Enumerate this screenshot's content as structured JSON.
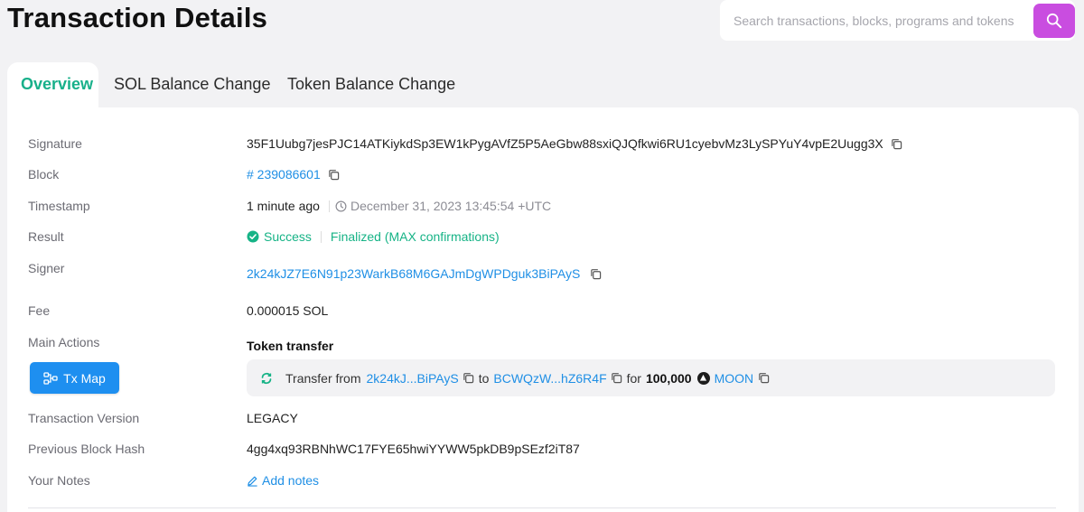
{
  "header": {
    "title": "Transaction Details",
    "search_placeholder": "Search transactions, blocks, programs and tokens"
  },
  "tabs": [
    {
      "label": "Overview",
      "active": true
    },
    {
      "label": "SOL Balance Change",
      "active": false
    },
    {
      "label": "Token Balance Change",
      "active": false
    }
  ],
  "details": {
    "signature": {
      "label": "Signature",
      "value": "35F1Uubg7jesPJC14ATKiykdSp3EW1kPygAVfZ5P5AeGbw88sxiQJQfkwi6RU1cyebvMz3LySPYuY4vpE2Uugg3X"
    },
    "block": {
      "label": "Block",
      "value": "# 239086601"
    },
    "timestamp": {
      "label": "Timestamp",
      "relative": "1 minute ago",
      "absolute": "December 31, 2023 13:45:54 +UTC"
    },
    "result": {
      "label": "Result",
      "status": "Success",
      "confirmation": "Finalized (MAX confirmations)"
    },
    "signer": {
      "label": "Signer",
      "value": "2k24kJZ7E6N91p23WarkB68M6GAJmDgWPDguk3BiPAyS"
    },
    "fee": {
      "label": "Fee",
      "value": "0.000015 SOL"
    },
    "main_actions": {
      "label": "Main Actions",
      "title": "Token transfer",
      "txmap_label": "Tx Map",
      "transfer_prefix": "Transfer from",
      "from": "2k24kJ...BiPAyS",
      "to_word": "to",
      "to": "BCWQzW...hZ6R4F",
      "for_word": "for",
      "amount": "100,000",
      "token": "MOON"
    },
    "version": {
      "label": "Transaction Version",
      "value": "LEGACY"
    },
    "prev_hash": {
      "label": "Previous Block Hash",
      "value": "4gg4xq93RBNhWC17FYE65hwiYYWW5pkDB9pSEzf2iT87"
    },
    "notes": {
      "label": "Your Notes",
      "value": "Add notes"
    }
  },
  "colors": {
    "accent_green": "#16b386",
    "link_blue": "#1f8fe5",
    "search_button": "#c94de0",
    "txmap_button": "#1e8ff0"
  }
}
